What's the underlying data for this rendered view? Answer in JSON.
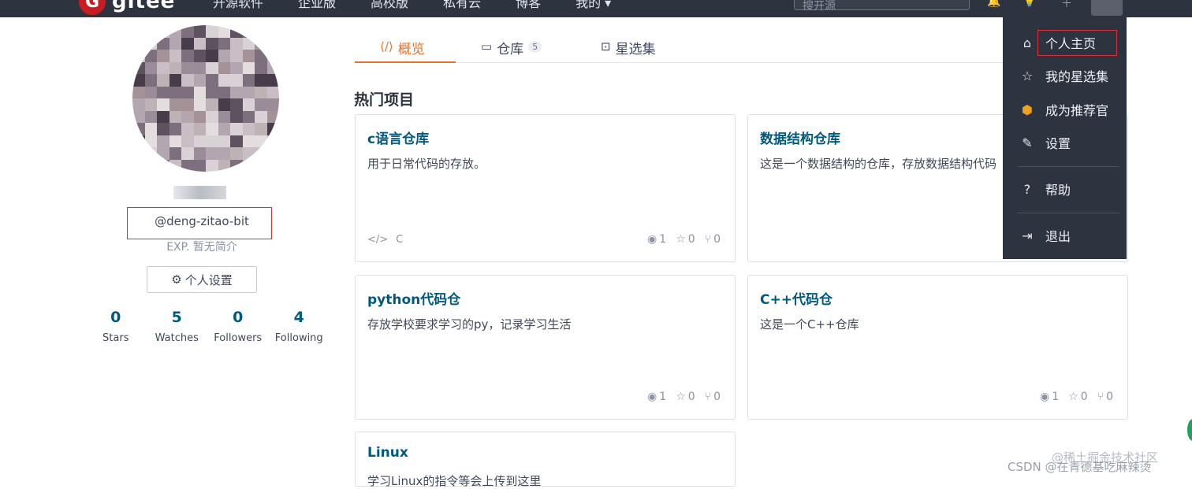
{
  "brand": {
    "name": "gitee",
    "mark": "G"
  },
  "nav": {
    "links": [
      "开源软件",
      "企业版",
      "高校版",
      "私有云",
      "博客",
      "我的"
    ],
    "search_placeholder": "搜开源"
  },
  "profile": {
    "username": "@deng-zitao-bit",
    "bio": "EXP. 暂无简介",
    "settings_button": "个人设置",
    "stats": [
      {
        "value": "0",
        "label": "Stars"
      },
      {
        "value": "5",
        "label": "Watches"
      },
      {
        "value": "0",
        "label": "Followers"
      },
      {
        "value": "4",
        "label": "Following"
      }
    ]
  },
  "tabs": [
    {
      "label": "概览",
      "icon": "overview-icon",
      "active": true
    },
    {
      "label": "仓库",
      "icon": "repo-icon",
      "badge": "5"
    },
    {
      "label": "星选集",
      "icon": "collection-icon"
    }
  ],
  "section_title": "热门项目",
  "projects": [
    {
      "title": "c语言仓库",
      "desc": "用于日常代码的存放。",
      "lang": "C",
      "watch": "1",
      "star": "0",
      "fork": "0"
    },
    {
      "title": "数据结构仓库",
      "desc": "这是一个数据结构的仓库，存放数据结构代码",
      "lang": "",
      "watch": "",
      "star": "",
      "fork": ""
    },
    {
      "title": "python代码仓",
      "desc": "存放学校要求学习的py，记录学习生活",
      "lang": "",
      "watch": "1",
      "star": "0",
      "fork": "0"
    },
    {
      "title": "C++代码仓",
      "desc": "这是一个C++仓库",
      "lang": "",
      "watch": "1",
      "star": "0",
      "fork": "0"
    },
    {
      "title": "Linux",
      "desc": "学习Linux的指令等会上传到这里"
    }
  ],
  "dropdown": {
    "items": [
      {
        "label": "个人主页",
        "icon": "home-icon"
      },
      {
        "label": "我的星选集",
        "icon": "star-icon"
      },
      {
        "label": "成为推荐官",
        "icon": "badge-icon"
      },
      {
        "label": "设置",
        "icon": "edit-icon"
      },
      {
        "label": "帮助",
        "icon": "help-icon"
      },
      {
        "label": "退出",
        "icon": "logout-icon"
      }
    ]
  },
  "watermark": {
    "line1": "@稀土掘金技术社区",
    "line2": "CSDN @在青德基吃麻辣烫"
  },
  "colors": {
    "nav_bg": "#2e3340",
    "accent": "#e8722c",
    "link": "#005980",
    "highlight": "#d9303a"
  }
}
